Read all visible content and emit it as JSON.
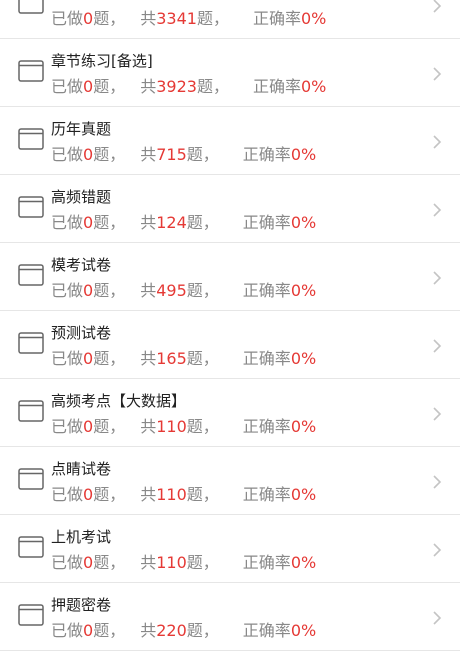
{
  "stat_labels": {
    "done_prefix": "已做",
    "done_suffix": "题，",
    "total_prefix": "共",
    "total_suffix": "题，",
    "accuracy_prefix": "正确率"
  },
  "items": [
    {
      "title": "",
      "done": "0",
      "total": "3341",
      "accuracy": "0%"
    },
    {
      "title": "章节练习[备选]",
      "done": "0",
      "total": "3923",
      "accuracy": "0%"
    },
    {
      "title": "历年真题",
      "done": "0",
      "total": "715",
      "accuracy": "0%"
    },
    {
      "title": "高频错题",
      "done": "0",
      "total": "124",
      "accuracy": "0%"
    },
    {
      "title": "模考试卷",
      "done": "0",
      "total": "495",
      "accuracy": "0%"
    },
    {
      "title": "预测试卷",
      "done": "0",
      "total": "165",
      "accuracy": "0%"
    },
    {
      "title": "高频考点【大数据】",
      "done": "0",
      "total": "110",
      "accuracy": "0%"
    },
    {
      "title": "点睛试卷",
      "done": "0",
      "total": "110",
      "accuracy": "0%"
    },
    {
      "title": "上机考试",
      "done": "0",
      "total": "110",
      "accuracy": "0%"
    },
    {
      "title": "押题密卷",
      "done": "0",
      "total": "220",
      "accuracy": "0%"
    }
  ],
  "colors": {
    "highlight": "#e53935",
    "muted_text": "#888888",
    "title_text": "#222222",
    "divider": "#e6e6e6"
  },
  "icons": {
    "item_icon": "folder-icon",
    "row_arrow": "chevron-right-icon"
  }
}
